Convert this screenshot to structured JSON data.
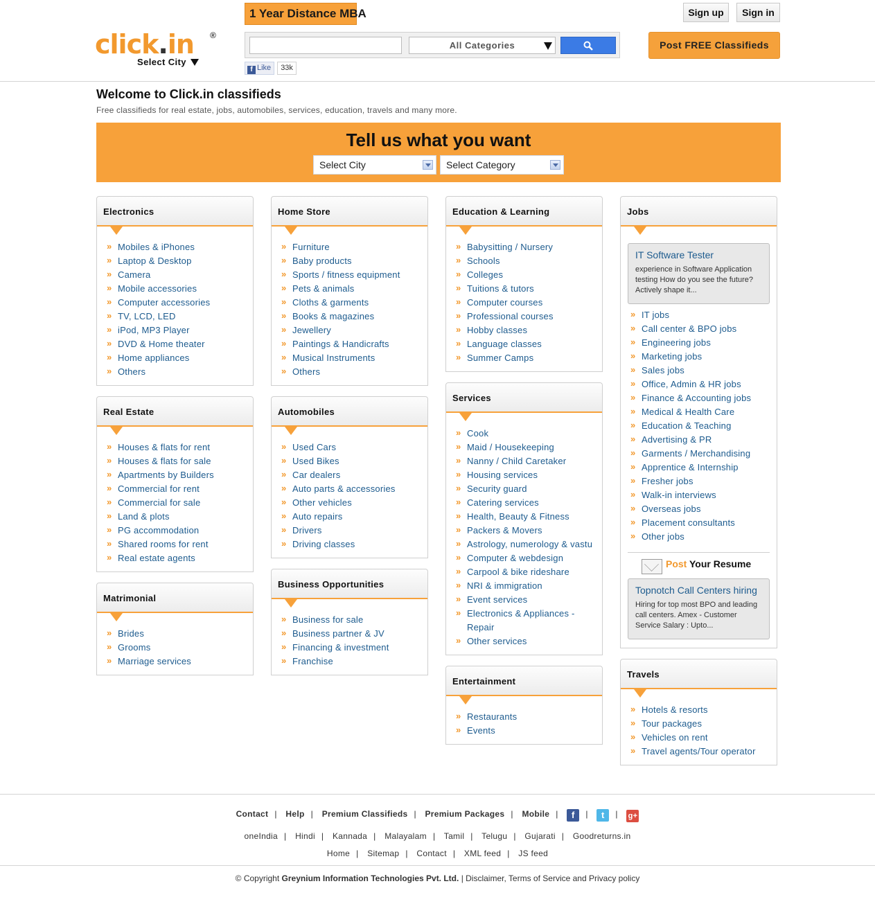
{
  "header": {
    "logo": {
      "name": "click",
      "dot": ".",
      "tld": "in",
      "reg": "®"
    },
    "select_city": "Select City",
    "ad_banner": "1 Year Distance MBA",
    "search": {
      "placeholder": "",
      "category": "All Categories"
    },
    "fb": {
      "label": "Like",
      "count": "33k"
    },
    "sign_up": "Sign up",
    "sign_in": "Sign in",
    "post_free": "Post FREE Classifieds"
  },
  "welcome": {
    "title": "Welcome to Click.in classifieds",
    "subtitle": "Free classifieds for real estate, jobs, automobiles, services, education, travels and many more."
  },
  "banner": {
    "heading": "Tell us what you want",
    "city_select": "Select City",
    "category_select": "Select Category"
  },
  "categories": {
    "electronics": {
      "title": "Electronics",
      "items": [
        "Mobiles & iPhones",
        "Laptop & Desktop",
        "Camera",
        "Mobile accessories",
        "Computer accessories",
        "TV, LCD, LED",
        "iPod, MP3 Player",
        "DVD & Home theater",
        "Home appliances",
        "Others"
      ]
    },
    "real_estate": {
      "title": "Real Estate",
      "items": [
        "Houses & flats for rent",
        "Houses & flats for sale",
        "Apartments by Builders",
        "Commercial for rent",
        "Commercial for sale",
        "Land & plots",
        "PG accommodation",
        "Shared rooms for rent",
        "Real estate agents"
      ]
    },
    "matrimonial": {
      "title": "Matrimonial",
      "items": [
        "Brides",
        "Grooms",
        "Marriage services"
      ]
    },
    "home_store": {
      "title": "Home Store",
      "items": [
        "Furniture",
        "Baby products",
        "Sports / fitness equipment",
        "Pets & animals",
        "Cloths & garments",
        "Books & magazines",
        "Jewellery",
        "Paintings & Handicrafts",
        "Musical Instruments",
        "Others"
      ]
    },
    "automobiles": {
      "title": "Automobiles",
      "items": [
        "Used Cars",
        "Used Bikes",
        "Car dealers",
        "Auto parts & accessories",
        "Other vehicles",
        "Auto repairs",
        "Drivers",
        "Driving classes"
      ]
    },
    "business": {
      "title": "Business Opportunities",
      "items": [
        "Business for sale",
        "Business partner & JV",
        "Financing & investment",
        "Franchise"
      ]
    },
    "education": {
      "title": "Education & Learning",
      "items": [
        "Babysitting / Nursery",
        "Schools",
        "Colleges",
        "Tuitions & tutors",
        "Computer courses",
        "Professional courses",
        "Hobby classes",
        "Language classes",
        "Summer Camps"
      ]
    },
    "services": {
      "title": "Services",
      "items": [
        "Cook",
        "Maid / Housekeeping",
        "Nanny / Child Caretaker",
        "Housing services",
        "Security guard",
        "Catering services",
        "Health, Beauty & Fitness",
        "Packers & Movers",
        "Astrology, numerology & vastu",
        "Computer & webdesign",
        "Carpool & bike rideshare",
        "NRI & immigration",
        "Event services",
        "Electronics & Appliances - Repair",
        "Other services"
      ]
    },
    "entertainment": {
      "title": "Entertainment",
      "items": [
        "Restaurants",
        "Events"
      ]
    },
    "jobs": {
      "title": "Jobs",
      "ad1": {
        "title": "IT Software Tester",
        "text": "experience in Software Application testing How do you see the future? Actively shape it..."
      },
      "items": [
        "IT jobs",
        "Call center & BPO jobs",
        "Engineering jobs",
        "Marketing jobs",
        "Sales jobs",
        "Office, Admin & HR jobs",
        "Finance & Accounting jobs",
        "Medical & Health Care",
        "Education & Teaching",
        "Advertising & PR",
        "Garments / Merchandising",
        "Apprentice & Internship",
        "Fresher jobs",
        "Walk-in interviews",
        "Overseas jobs",
        "Placement consultants",
        "Other jobs"
      ],
      "post_resume": {
        "post": "Post",
        "rest": "Your Resume"
      },
      "ad2": {
        "title": "Topnotch Call Centers hiring",
        "text": "Hiring for top most BPO and leading call centers. Amex - Customer Service Salary : Upto..."
      }
    },
    "travels": {
      "title": "Travels",
      "items": [
        "Hotels & resorts",
        "Tour packages",
        "Vehicles on rent",
        "Travel agents/Tour operator"
      ]
    }
  },
  "footer": {
    "row1": [
      "Contact",
      "Help",
      "Premium Classifieds",
      "Premium Packages",
      "Mobile"
    ],
    "social": {
      "fb": "f",
      "tw": "t",
      "gp": "g+"
    },
    "row2": [
      "oneIndia",
      "Hindi",
      "Kannada",
      "Malayalam",
      "Tamil",
      "Telugu",
      "Gujarati",
      "Goodreturns.in"
    ],
    "row3": [
      "Home",
      "Sitemap",
      "Contact",
      "XML feed",
      "JS feed"
    ],
    "copyright_prefix": "© Copyright",
    "company": "Greynium Information Technologies Pvt. Ltd.",
    "copyright_suffix": "| Disclaimer, Terms of Service and Privacy policy"
  },
  "colors": {
    "accent": "#f7a13a",
    "link": "#1d5b8e",
    "search_button": "#3b7be5"
  }
}
